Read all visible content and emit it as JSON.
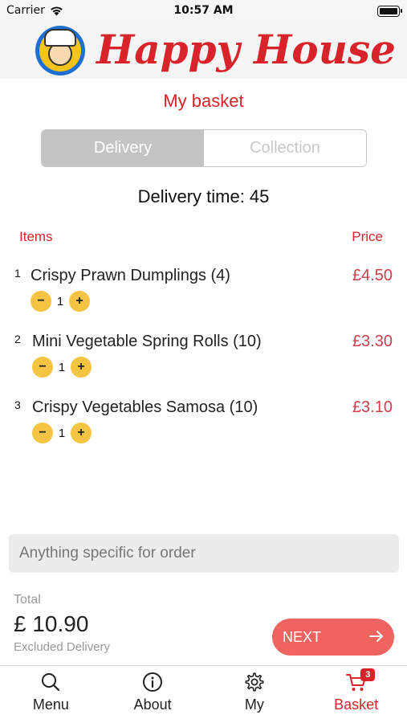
{
  "status_bar": {
    "carrier": "Carrier",
    "time": "10:57 AM"
  },
  "header": {
    "brand": "Happy House"
  },
  "page_title": "My basket",
  "segment": {
    "options": [
      "Delivery",
      "Collection"
    ],
    "selected": "Delivery"
  },
  "delivery_time": "Delivery time: 45",
  "columns": {
    "items": "Items",
    "price": "Price"
  },
  "items": [
    {
      "num": "1",
      "name": "Crispy Prawn Dumplings (4)",
      "price": "£4.50",
      "qty": "1"
    },
    {
      "num": "2",
      "name": "Mini Vegetable Spring Rolls (10)",
      "price": "£3.30",
      "qty": "1"
    },
    {
      "num": "3",
      "name": "Crispy Vegetables Samosa (10)",
      "price": "£3.10",
      "qty": "1"
    }
  ],
  "qty_controls": {
    "minus": "−",
    "plus": "+"
  },
  "note": {
    "placeholder": "Anything specific for order",
    "value": ""
  },
  "total": {
    "label": "Total",
    "amount": "£ 10.90",
    "note": "Excluded Delivery"
  },
  "next_button": {
    "label": "NEXT"
  },
  "tabs": [
    {
      "label": "Menu",
      "icon": "search-icon"
    },
    {
      "label": "About",
      "icon": "info-icon"
    },
    {
      "label": "My",
      "icon": "gear-icon"
    },
    {
      "label": "Basket",
      "icon": "cart-icon",
      "badge": "3",
      "active": true
    }
  ],
  "colors": {
    "brand_red": "#d8232a",
    "qty_yellow": "#f5c443",
    "next_coral": "#ef6461",
    "price_red": "#c9404a"
  }
}
